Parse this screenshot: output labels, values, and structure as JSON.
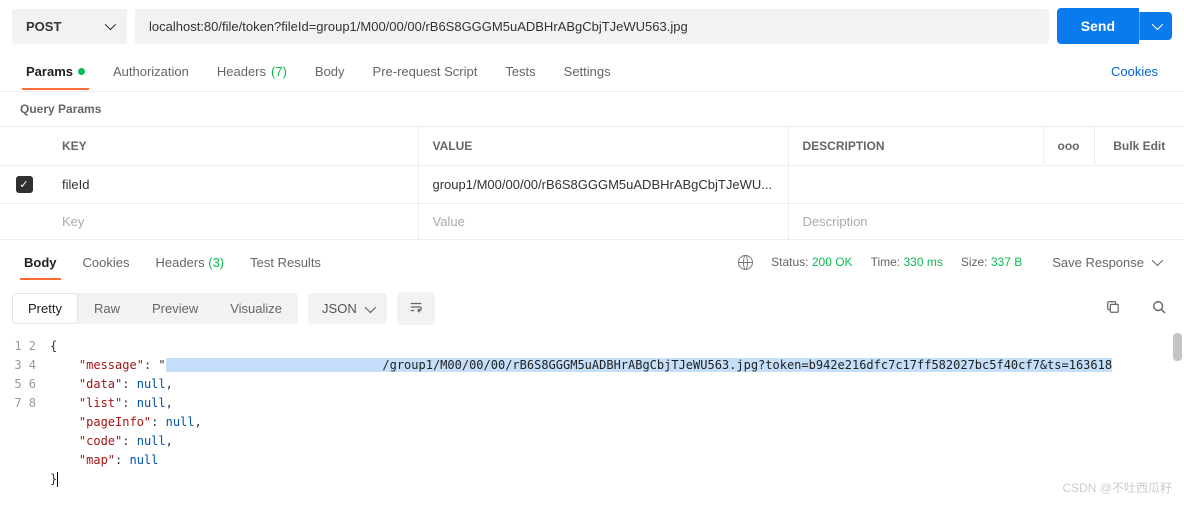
{
  "request": {
    "method": "POST",
    "url": "localhost:80/file/token?fileId=group1/M00/00/00/rB6S8GGGM5uADBHrABgCbjTJeWU563.jpg",
    "send_label": "Send"
  },
  "tabs": {
    "params": "Params",
    "authorization": "Authorization",
    "headers": "Headers",
    "headers_count": "(7)",
    "body": "Body",
    "prerequest": "Pre-request Script",
    "tests": "Tests",
    "settings": "Settings",
    "cookies_link": "Cookies"
  },
  "query_params": {
    "title": "Query Params",
    "columns": {
      "key": "KEY",
      "value": "VALUE",
      "description": "DESCRIPTION"
    },
    "more": "ooo",
    "bulk_edit": "Bulk Edit",
    "rows": [
      {
        "key": "fileId",
        "value": "group1/M00/00/00/rB6S8GGGM5uADBHrABgCbjTJeWU...",
        "description": ""
      }
    ],
    "placeholders": {
      "key": "Key",
      "value": "Value",
      "description": "Description"
    }
  },
  "response": {
    "tabs": {
      "body": "Body",
      "cookies": "Cookies",
      "headers": "Headers",
      "headers_count": "(3)",
      "tests": "Test Results"
    },
    "status_label": "Status:",
    "status_value": "200 OK",
    "time_label": "Time:",
    "time_value": "330 ms",
    "size_label": "Size:",
    "size_value": "337 B",
    "save_response": "Save Response",
    "view_modes": {
      "pretty": "Pretty",
      "raw": "Raw",
      "preview": "Preview",
      "visualize": "Visualize"
    },
    "format": "JSON",
    "json": {
      "message_highlight_url": "/group1/M00/00/00/rB6S8GGGM5uADBHrABgCbjTJeWU563.jpg?token=b942e216dfc7c17ff582027bc5f40cf7&ts=163618",
      "data": "null",
      "list": "null",
      "pageInfo": "null",
      "code": "null",
      "map": "null"
    }
  },
  "watermark": "CSDN @不吐西瓜籽"
}
